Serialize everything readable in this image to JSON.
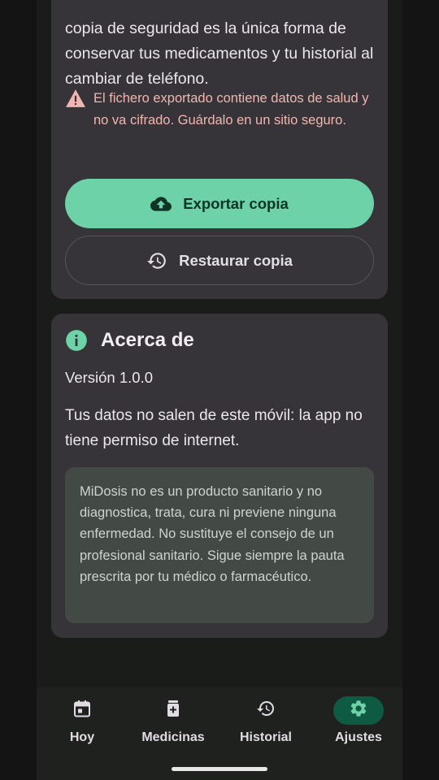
{
  "backup": {
    "description": "copia de seguridad es la única forma de conservar tus medicamentos y tu historial al cambiar de teléfono.",
    "warning": "El fichero exportado contiene datos de salud y no va cifrado. Guárdalo en un sitio seguro.",
    "export_label": "Exportar copia",
    "restore_label": "Restaurar copia"
  },
  "about": {
    "title": "Acerca de",
    "version": "Versión 1.0.0",
    "privacy": "Tus datos no salen de este móvil: la app no tiene permiso de internet.",
    "disclaimer": "MiDosis no es un producto sanitario y no diagnostica, trata, cura ni previene ninguna enfermedad. No sustituye el consejo de un profesional sanitario. Sigue siempre la pauta prescrita por tu médico o farmacéutico."
  },
  "nav": {
    "items": [
      {
        "label": "Hoy",
        "icon": "calendar-icon",
        "active": false
      },
      {
        "label": "Medicinas",
        "icon": "medicine-icon",
        "active": false
      },
      {
        "label": "Historial",
        "icon": "history-icon",
        "active": false
      },
      {
        "label": "Ajustes",
        "icon": "gear-icon",
        "active": true
      }
    ]
  },
  "colors": {
    "accent": "#6dd2a8",
    "warning": "#f2b6b0",
    "active_pill": "#0f5a43"
  }
}
